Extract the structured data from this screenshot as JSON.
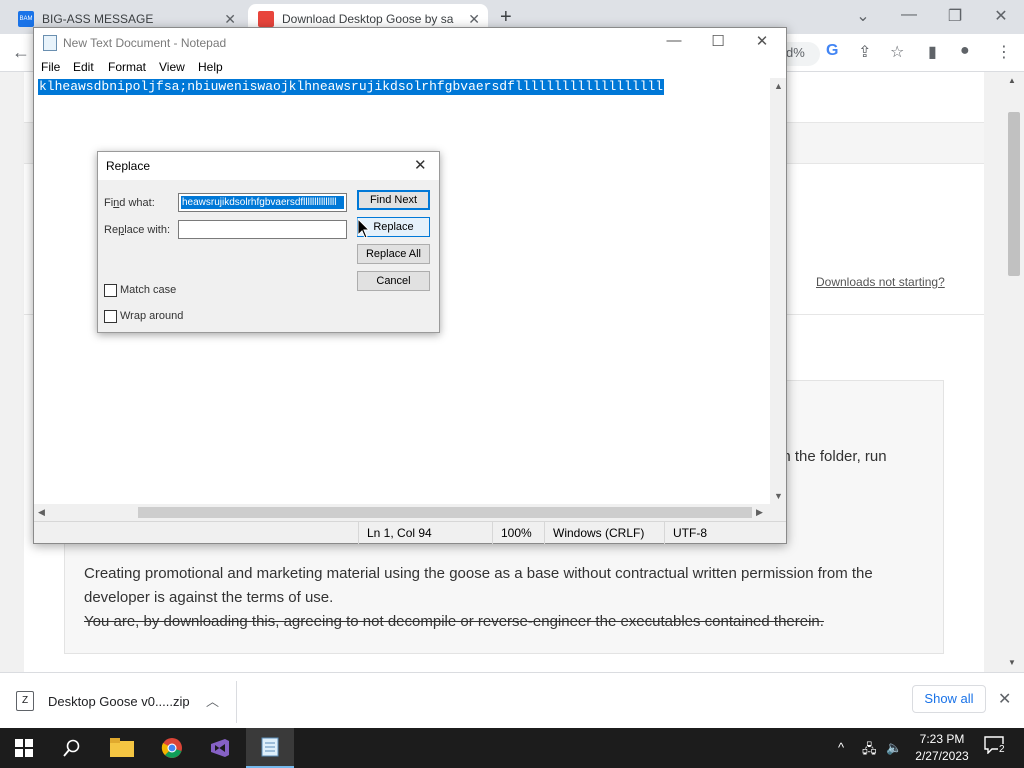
{
  "browser": {
    "tabs": [
      {
        "title": "BIG-ASS MESSAGE",
        "favicon_text": "BAM",
        "favicon_color": "#1a73e8",
        "active": false
      },
      {
        "title": "Download Desktop Goose by sa",
        "favicon_color": "#e8453c",
        "active": true
      }
    ],
    "omnibox_tail": "d%",
    "page": {
      "downloads_link": "Downloads not starting?",
      "partial_text": "en the folder, run",
      "notice_line1": "Creating promotional and marketing material using the goose as a base without contractual written permission from the developer is against the terms of use.",
      "notice_line2": "You are, by downloading this, agreeing to not decompile or reverse-engineer the executables contained therein."
    }
  },
  "notepad": {
    "title": "New Text Document - Notepad",
    "menu": [
      "File",
      "Edit",
      "Format",
      "View",
      "Help"
    ],
    "content": "klheawsdbnipoljfsa;nbiuweniswaojklhneawsrujikdsolrhfgbvaersdflllllllllllllllllll",
    "status": {
      "position": "Ln 1, Col 94",
      "zoom": "100%",
      "line_ending": "Windows (CRLF)",
      "encoding": "UTF-8"
    }
  },
  "replace_dialog": {
    "title": "Replace",
    "find_label_pre": "Fi",
    "find_label_u": "n",
    "find_label_post": "d what:",
    "find_value": "heawsrujikdsolrhfgbvaersdflllllllllllllll",
    "replace_label_pre": "Re",
    "replace_label_u": "p",
    "replace_label_post": "lace with:",
    "replace_value": "",
    "buttons": {
      "find_next": "Find Next",
      "replace": "Replace",
      "replace_all": "Replace All",
      "cancel": "Cancel"
    },
    "options": {
      "match_case": {
        "label": "Match case",
        "checked": false
      },
      "wrap_around": {
        "label": "Wrap around",
        "checked": false
      }
    }
  },
  "download_shelf": {
    "file_name": "Desktop Goose v0.....zip",
    "show_all": "Show all"
  },
  "taskbar": {
    "time": "7:23 PM",
    "date": "2/27/2023",
    "notifications": "2"
  },
  "colors": {
    "selection": "#0078d7",
    "taskbar": "#1c1c1c",
    "chrome_tabstrip": "#dee1e6"
  }
}
